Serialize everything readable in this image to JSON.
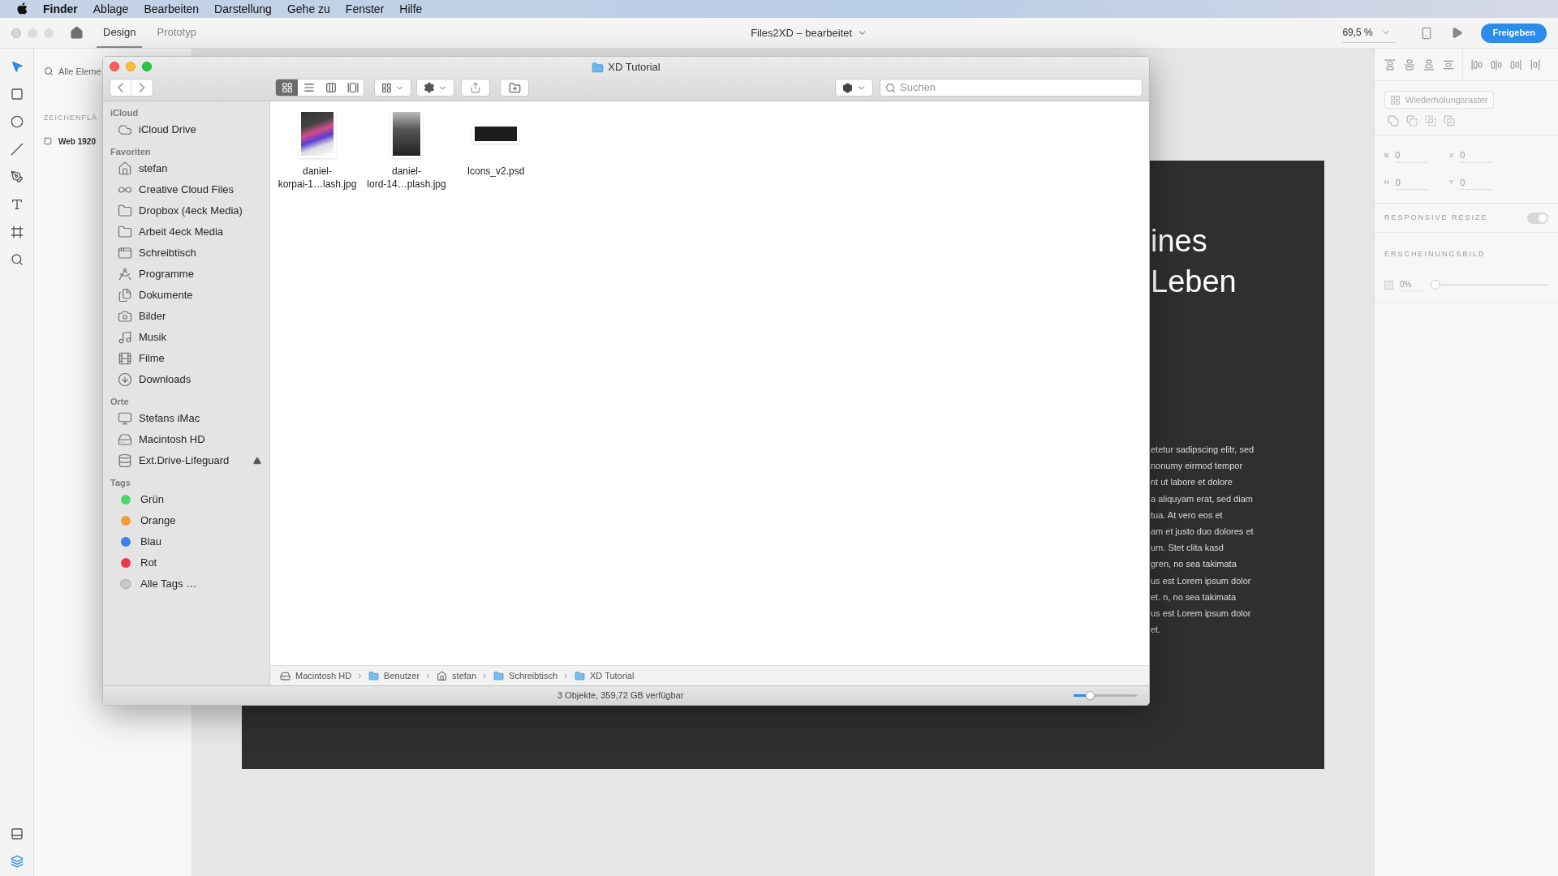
{
  "menu_bar": {
    "app": "Finder",
    "items": [
      "Ablage",
      "Bearbeiten",
      "Darstellung",
      "Gehe zu",
      "Fenster",
      "Hilfe"
    ]
  },
  "xd_toolbar": {
    "tabs": [
      {
        "label": "Design",
        "selected": true
      },
      {
        "label": "Prototyp",
        "selected": false
      }
    ],
    "document_title": "Files2XD – bearbeitet",
    "zoom": "69,5 %",
    "share_button": "Freigeben"
  },
  "layers_panel": {
    "search_placeholder": "Alle Eleme",
    "section": "ZEICHENFLÄ",
    "artboards": [
      "Web 1920"
    ]
  },
  "artboard": {
    "headings": [
      "ines",
      "Leben"
    ],
    "paragraph_lines": [
      "etetur sadipscing elitr, sed",
      "nonumy eirmod tempor",
      "nt ut labore et dolore",
      "a aliquyam erat, sed diam",
      "tua. At vero eos et",
      "am et justo duo dolores et",
      "um. Stet clita kasd",
      "gren, no sea takimata",
      "us est Lorem ipsum dolor",
      "et. n, no sea takimata",
      "us est Lorem ipsum dolor",
      "et."
    ]
  },
  "right_panel": {
    "repeat_grid_button": "Wiederholungsraster",
    "fields": [
      {
        "label": "B",
        "value": "0"
      },
      {
        "label": "X",
        "value": "0"
      },
      {
        "label": "H",
        "value": "0"
      },
      {
        "label": "Y",
        "value": "0"
      }
    ],
    "responsive_resize": {
      "label": "RESPONSIVE RESIZE",
      "on": true
    },
    "appearance": {
      "label": "ERSCHEINUNGSBILD",
      "opacity": "0%",
      "level": 0
    }
  },
  "finder": {
    "title": "XD Tutorial",
    "view_modes": [
      {
        "kind": "icons",
        "selected": true
      },
      {
        "kind": "list",
        "selected": false
      },
      {
        "kind": "columns",
        "selected": false
      },
      {
        "kind": "gallery",
        "selected": false
      }
    ],
    "search": {
      "placeholder": "Suchen"
    },
    "sidebar": [
      {
        "title": "iCloud",
        "items": [
          {
            "label": "iCloud Drive",
            "kind": "cloud",
            "ejectable": false
          }
        ]
      },
      {
        "title": "Favoriten",
        "items": [
          {
            "label": "stefan",
            "kind": "home",
            "ejectable": false
          },
          {
            "label": "Creative Cloud Files",
            "kind": "rings",
            "ejectable": false
          },
          {
            "label": "Dropbox (4eck Media)",
            "kind": "folder",
            "ejectable": false
          },
          {
            "label": "Arbeit 4eck Media",
            "kind": "folder",
            "ejectable": false
          },
          {
            "label": "Schreibtisch",
            "kind": "desktop",
            "ejectable": false
          },
          {
            "label": "Programme",
            "kind": "apps",
            "ejectable": false
          },
          {
            "label": "Dokumente",
            "kind": "documents",
            "ejectable": false
          },
          {
            "label": "Bilder",
            "kind": "camera",
            "ejectable": false
          },
          {
            "label": "Musik",
            "kind": "music",
            "ejectable": false
          },
          {
            "label": "Filme",
            "kind": "film",
            "ejectable": false
          },
          {
            "label": "Downloads",
            "kind": "download",
            "ejectable": false
          }
        ]
      },
      {
        "title": "Orte",
        "items": [
          {
            "label": "Stefans iMac",
            "kind": "computer",
            "ejectable": false
          },
          {
            "label": "Macintosh HD",
            "kind": "disk",
            "ejectable": false
          },
          {
            "label": "Ext.Drive-Lifeguard",
            "kind": "drive",
            "ejectable": true
          }
        ]
      },
      {
        "title": "Tags",
        "items": [
          {
            "label": "Grün",
            "kind": "tag",
            "color": "#4cd964"
          },
          {
            "label": "Orange",
            "kind": "tag",
            "color": "#f39a3b"
          },
          {
            "label": "Blau",
            "kind": "tag",
            "color": "#3d7ff0"
          },
          {
            "label": "Rot",
            "kind": "tag",
            "color": "#e8384a"
          },
          {
            "label": "Alle Tags …",
            "kind": "all-tags"
          }
        ]
      }
    ],
    "files": [
      {
        "name_lines": [
          "daniel-",
          "korpai-1…lash.jpg"
        ],
        "kind": "photo"
      },
      {
        "name_lines": [
          "daniel-",
          "lord-14…plash.jpg"
        ],
        "kind": "photo-dark"
      },
      {
        "name_lines": [
          "Icons_v2.psd"
        ],
        "kind": "psd"
      }
    ],
    "path": [
      {
        "label": "Macintosh HD",
        "kind": "disk"
      },
      {
        "label": "Benutzer",
        "kind": "folder"
      },
      {
        "label": "stefan",
        "kind": "home"
      },
      {
        "label": "Schreibtisch",
        "kind": "folder"
      },
      {
        "label": "XD Tutorial",
        "kind": "folder"
      }
    ],
    "status": "3 Objekte, 359,72 GB verfügbar",
    "icon_size": {
      "level": 0.25
    }
  }
}
